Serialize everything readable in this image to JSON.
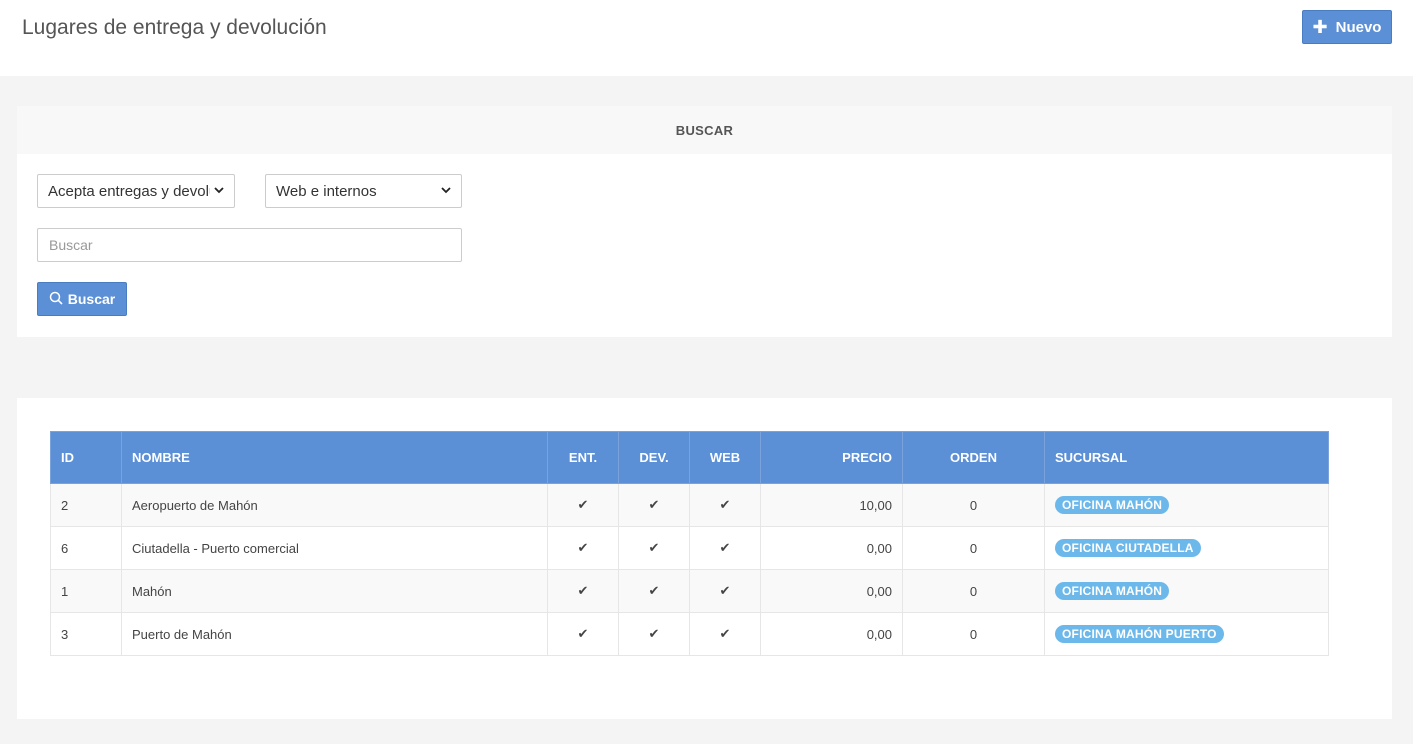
{
  "header": {
    "title": "Lugares de entrega y devolución",
    "new_button_label": "Nuevo"
  },
  "search": {
    "section_title": "BUSCAR",
    "filter_type_value": "Acepta entregas y devolu",
    "filter_channel_value": "Web e internos",
    "input_placeholder": "Buscar",
    "button_label": "Buscar"
  },
  "table": {
    "columns": [
      "ID",
      "NOMBRE",
      "ENT.",
      "DEV.",
      "WEB",
      "PRECIO",
      "ORDEN",
      "SUCURSAL"
    ],
    "rows": [
      {
        "id": "2",
        "nombre": "Aeropuerto de Mahón",
        "ent": "✔",
        "dev": "✔",
        "web": "✔",
        "precio": "10,00",
        "orden": "0",
        "sucursal": "OFICINA MAHÓN"
      },
      {
        "id": "6",
        "nombre": "Ciutadella - Puerto comercial",
        "ent": "✔",
        "dev": "✔",
        "web": "✔",
        "precio": "0,00",
        "orden": "0",
        "sucursal": "OFICINA CIUTADELLA"
      },
      {
        "id": "1",
        "nombre": "Mahón",
        "ent": "✔",
        "dev": "✔",
        "web": "✔",
        "precio": "0,00",
        "orden": "0",
        "sucursal": "OFICINA MAHÓN"
      },
      {
        "id": "3",
        "nombre": "Puerto de Mahón",
        "ent": "✔",
        "dev": "✔",
        "web": "✔",
        "precio": "0,00",
        "orden": "0",
        "sucursal": "OFICINA MAHÓN PUERTO"
      }
    ]
  },
  "colors": {
    "primary": "#5b8fd6",
    "badge": "#6cb8ea",
    "page_background": "#f4f4f4"
  },
  "icons": {
    "new": "plus-icon",
    "search": "magnifier-icon",
    "select": "chevron-down-icon",
    "check": "check-icon"
  }
}
